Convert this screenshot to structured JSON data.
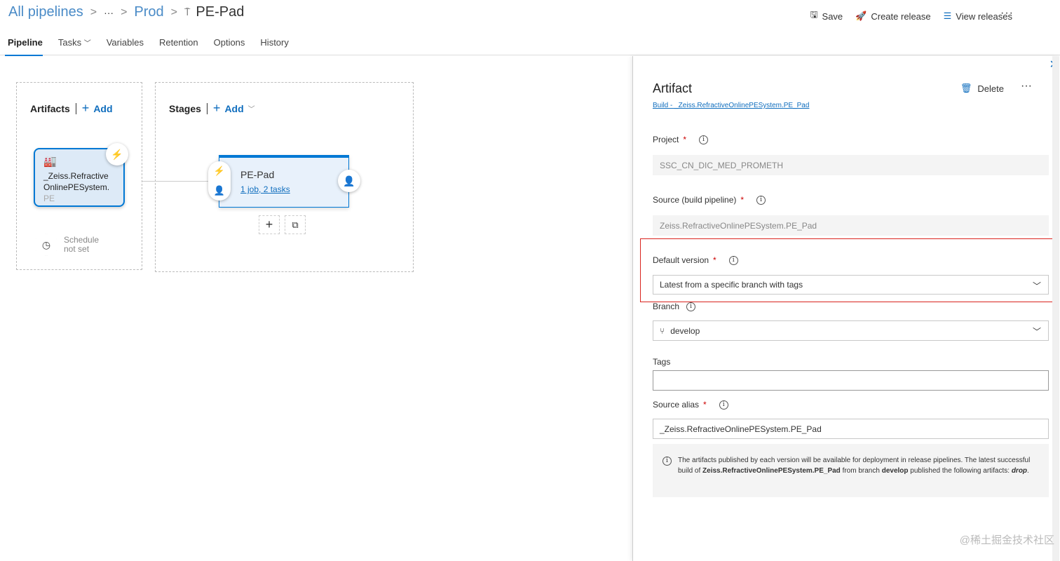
{
  "breadcrumb": {
    "root": "All pipelines",
    "ellipsis": "···",
    "folder": "Prod",
    "current": "PE-Pad"
  },
  "toolbar": {
    "save": "Save",
    "create_release": "Create release",
    "view_releases": "View releases",
    "more": "···"
  },
  "tabs": [
    {
      "label": "Pipeline",
      "active": true
    },
    {
      "label": "Tasks"
    },
    {
      "label": "Variables"
    },
    {
      "label": "Retention"
    },
    {
      "label": "Options"
    },
    {
      "label": "History"
    }
  ],
  "artifacts": {
    "heading": "Artifacts",
    "add": "Add",
    "card_name": "_Zeiss.RefractiveOnlinePESystem.",
    "card_fade": "PE",
    "schedule_line1": "Schedule",
    "schedule_line2": "not set"
  },
  "stages": {
    "heading": "Stages",
    "add": "Add",
    "stage_name": "PE-Pad",
    "stage_link": "1 job, 2 tasks"
  },
  "panel": {
    "title": "Artifact",
    "subtitle": "Build - _Zeiss.RefractiveOnlinePESystem.PE_Pad",
    "delete": "Delete",
    "more": "···",
    "close": "✕",
    "project_label": "Project",
    "project_value": "SSC_CN_DIC_MED_PROMETH",
    "source_label": "Source (build pipeline)",
    "source_value": "Zeiss.RefractiveOnlinePESystem.PE_Pad",
    "default_version_label": "Default version",
    "default_version_value": "Latest from a specific branch with tags",
    "branch_label": "Branch",
    "branch_value": "develop",
    "tags_label": "Tags",
    "tags_value": "",
    "alias_label": "Source alias",
    "alias_value": "_Zeiss.RefractiveOnlinePESystem.PE_Pad",
    "note_1": "The artifacts published by each version will be available for deployment in release pipelines. The latest successful build of ",
    "note_build": "Zeiss.RefractiveOnlinePESystem.PE_Pad",
    "note_2": " from branch ",
    "note_branch": "develop",
    "note_3": " published the following artifacts: ",
    "note_artifact": "drop",
    "note_4": "."
  },
  "watermark": "@稀土掘金技术社区",
  "colors": {
    "accent": "#0078d4",
    "highlight": "#d9231e"
  }
}
